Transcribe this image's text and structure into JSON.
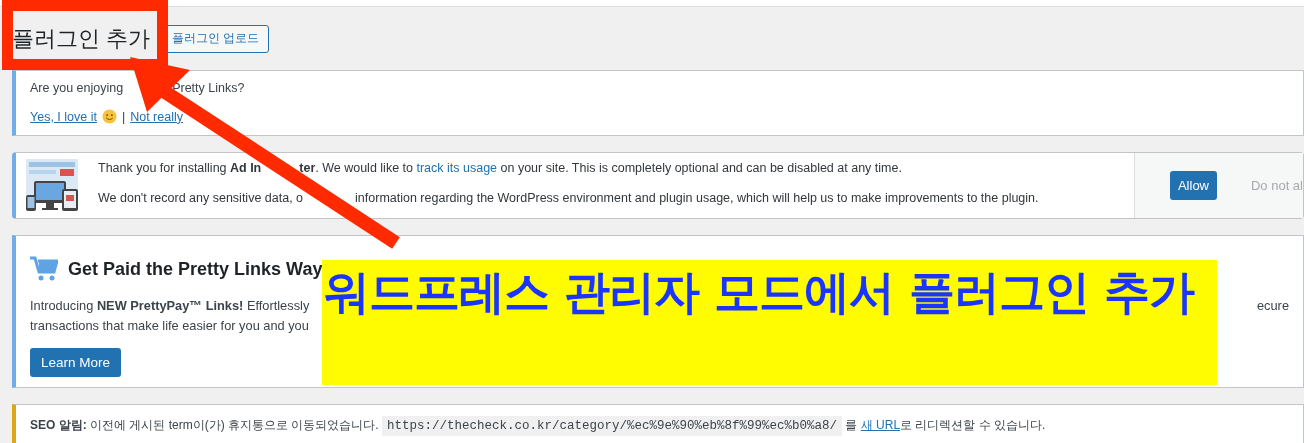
{
  "header": {
    "title": "플러그인 추가",
    "upload_button": "플러그인 업로드"
  },
  "feedback_notice": {
    "question_parts": [
      "Are you enjoying",
      "Pretty Links?"
    ],
    "yes_link": "Yes, I love it",
    "separator": "|",
    "no_link": "Not really"
  },
  "tracking_notice": {
    "line1_start": "Thank you for installing **Ad In**",
    "line1_rest": "**ter**. We would like to",
    "link": "track its usage",
    "line1_end": "on your site. This is completely optional and can be disabled at any time.",
    "line2_parts": [
      "We don't record any sensitive data, o",
      "information regarding the WordPress environment and plugin usage, which will help us to make improvements to the plugin."
    ],
    "allow_button": "Allow",
    "deny_button": "Do not al"
  },
  "promo_notice": {
    "title": "Get Paid the Pretty Links Way",
    "text_left": "Introducing **NEW PrettyPay™ Links!** Effortlessly",
    "text_right": "ecure",
    "text_line2": "transactions that make life easier for you and you",
    "button": "Learn More"
  },
  "seo_notice": {
    "label": "SEO 알림:",
    "text": "이전에 게시된 term이(가) 휴지통으로 이동되었습니다.",
    "url": "https://thecheck.co.kr/category/%ec%9e%90%eb%8f%99%ec%b0%a8/",
    "text2": "를",
    "link": "새 URL",
    "text3": "로 리디렉션할 수 있습니다."
  },
  "annotation": {
    "caption": "워드프레스 관리자 모드에서 플러그인 추가"
  }
}
